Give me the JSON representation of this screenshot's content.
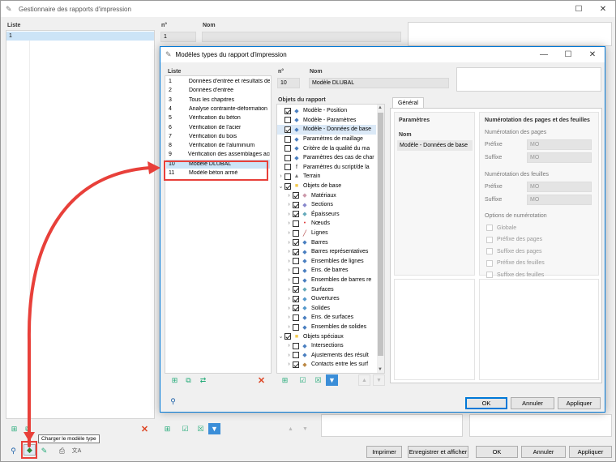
{
  "main_window": {
    "title": "Gestionnaire des rapports d'impression",
    "list_header": "Liste",
    "list_items": [
      {
        "num": "1"
      }
    ],
    "num_header": "n°",
    "num_value": "1",
    "name_header": "Nom",
    "buttons": {
      "print": "Imprimer",
      "save_display": "Enregistrer et afficher",
      "ok": "OK",
      "cancel": "Annuler",
      "apply": "Appliquer"
    },
    "tooltip": "Charger le modèle type"
  },
  "dialog": {
    "title": "Modèles types du rapport d'impression",
    "list_header": "Liste",
    "templates": [
      {
        "num": "1",
        "name": "Données d'entrée et résultats de"
      },
      {
        "num": "2",
        "name": "Données d'entrée"
      },
      {
        "num": "3",
        "name": "Tous les chapitres"
      },
      {
        "num": "4",
        "name": "Analyse contrainte-déformation"
      },
      {
        "num": "5",
        "name": "Vérification du béton"
      },
      {
        "num": "6",
        "name": "Vérification de l'acier"
      },
      {
        "num": "7",
        "name": "Vérification du bois"
      },
      {
        "num": "8",
        "name": "Vérification de l'aluminium"
      },
      {
        "num": "9",
        "name": "Vérification des assemblages acie"
      },
      {
        "num": "10",
        "name": "Modèle DLUBAL"
      },
      {
        "num": "11",
        "name": "Modèle béton armé"
      }
    ],
    "num_header": "n°",
    "num_value": "10",
    "name_header": "Nom",
    "name_value": "Modèle DLUBAL",
    "objects_header": "Objets du rapport",
    "tree": [
      {
        "label": "Modèle - Position",
        "icon": "model-position-icon",
        "checked": true,
        "level": 0,
        "exp": false
      },
      {
        "label": "Modèle - Paramètres",
        "icon": "model-params-icon",
        "checked": false,
        "level": 0,
        "exp": false
      },
      {
        "label": "Modèle - Données de base",
        "icon": "model-basedata-icon",
        "checked": true,
        "level": 0,
        "exp": false,
        "sel": true
      },
      {
        "label": "Paramètres de maillage",
        "icon": "mesh-icon",
        "checked": false,
        "level": 0,
        "exp": false
      },
      {
        "label": "Critère de la qualité du ma",
        "icon": "quality-icon",
        "checked": false,
        "level": 0,
        "exp": false
      },
      {
        "label": "Paramètres des cas de char",
        "icon": "loadcase-icon",
        "checked": false,
        "level": 0,
        "exp": false
      },
      {
        "label": "Paramètres du script/de la",
        "icon": "script-icon",
        "checked": false,
        "level": 0,
        "exp": false
      },
      {
        "label": "Terrain",
        "icon": "terrain-icon",
        "checked": false,
        "level": 0,
        "exp": "right"
      },
      {
        "label": "Objets de base",
        "icon": "folder-icon",
        "checked": true,
        "level": 0,
        "exp": "down"
      },
      {
        "label": "Matériaux",
        "icon": "materials-icon",
        "checked": true,
        "level": 1,
        "exp": "right"
      },
      {
        "label": "Sections",
        "icon": "sections-icon",
        "checked": true,
        "level": 1,
        "exp": "right"
      },
      {
        "label": "Épaisseurs",
        "icon": "thickness-icon",
        "checked": true,
        "level": 1,
        "exp": "right"
      },
      {
        "label": "Nœuds",
        "icon": "node-icon",
        "checked": false,
        "level": 1,
        "exp": "right"
      },
      {
        "label": "Lignes",
        "icon": "line-icon",
        "checked": false,
        "level": 1,
        "exp": "right"
      },
      {
        "label": "Barres",
        "icon": "member-icon",
        "checked": true,
        "level": 1,
        "exp": "right"
      },
      {
        "label": "Barres représentatives",
        "icon": "rep-member-icon",
        "checked": true,
        "level": 1,
        "exp": "right"
      },
      {
        "label": "Ensembles de lignes",
        "icon": "lineset-icon",
        "checked": false,
        "level": 1,
        "exp": "right"
      },
      {
        "label": "Ens. de barres",
        "icon": "memberset-icon",
        "checked": false,
        "level": 1,
        "exp": "right"
      },
      {
        "label": "Ensembles de barres re",
        "icon": "rep-memberset-icon",
        "checked": false,
        "level": 1,
        "exp": "right"
      },
      {
        "label": "Surfaces",
        "icon": "surface-icon",
        "checked": true,
        "level": 1,
        "exp": "right"
      },
      {
        "label": "Ouvertures",
        "icon": "opening-icon",
        "checked": true,
        "level": 1,
        "exp": "right"
      },
      {
        "label": "Solides",
        "icon": "solid-icon",
        "checked": true,
        "level": 1,
        "exp": "right"
      },
      {
        "label": "Ens. de surfaces",
        "icon": "surfaceset-icon",
        "checked": false,
        "level": 1,
        "exp": "right"
      },
      {
        "label": "Ensembles de solides",
        "icon": "solidset-icon",
        "checked": false,
        "level": 1,
        "exp": "right"
      },
      {
        "label": "Objets spéciaux",
        "icon": "folder-icon",
        "checked": true,
        "level": 0,
        "exp": "down"
      },
      {
        "label": "Intersections",
        "icon": "intersection-icon",
        "checked": false,
        "level": 1,
        "exp": "right"
      },
      {
        "label": "Ajustements des résult",
        "icon": "adjust-icon",
        "checked": false,
        "level": 1,
        "exp": "right"
      },
      {
        "label": "Contacts entre les surf",
        "icon": "contact-icon",
        "checked": true,
        "level": 1,
        "exp": "right"
      }
    ],
    "tab_general": "Général",
    "params_header": "Paramètres",
    "params_name_header": "Nom",
    "params_name_value": "Modèle - Données de base",
    "numbering_header": "Numérotation des pages et des feuilles",
    "page_numbering": "Numérotation des pages",
    "sheet_numbering": "Numérotation des feuilles",
    "prefix_label": "Préfixe",
    "suffix_label": "Suffixe",
    "page_prefix": "MO",
    "page_suffix": "MO",
    "sheet_prefix": "MO",
    "sheet_suffix": "MO",
    "options_header": "Options de numérotation",
    "options": [
      "Globale",
      "Préfixe des pages",
      "Suffixe des pages",
      "Préfixe des feuilles",
      "Suffixe des feuilles"
    ],
    "buttons": {
      "ok": "OK",
      "cancel": "Annuler",
      "apply": "Appliquer"
    }
  },
  "colors": {
    "highlight": "#e8403a",
    "selection": "#cce4f7",
    "accent": "#0078d7"
  }
}
